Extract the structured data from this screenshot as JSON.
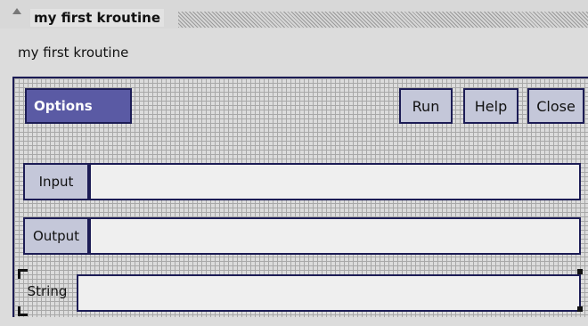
{
  "window": {
    "title": "my first kroutine"
  },
  "header": {
    "subtitle": "my first kroutine"
  },
  "toolbar": {
    "options_label": "Options",
    "run_label": "Run",
    "help_label": "Help",
    "close_label": "Close"
  },
  "fields": {
    "input": {
      "label": "Input",
      "value": ""
    },
    "output": {
      "label": "Output",
      "value": ""
    },
    "string": {
      "label": "String",
      "value": ""
    }
  },
  "colors": {
    "accent": "#5a5aa4",
    "border": "#1c1c55",
    "button_bg": "#c4c7d9",
    "field_bg": "#efefef"
  }
}
